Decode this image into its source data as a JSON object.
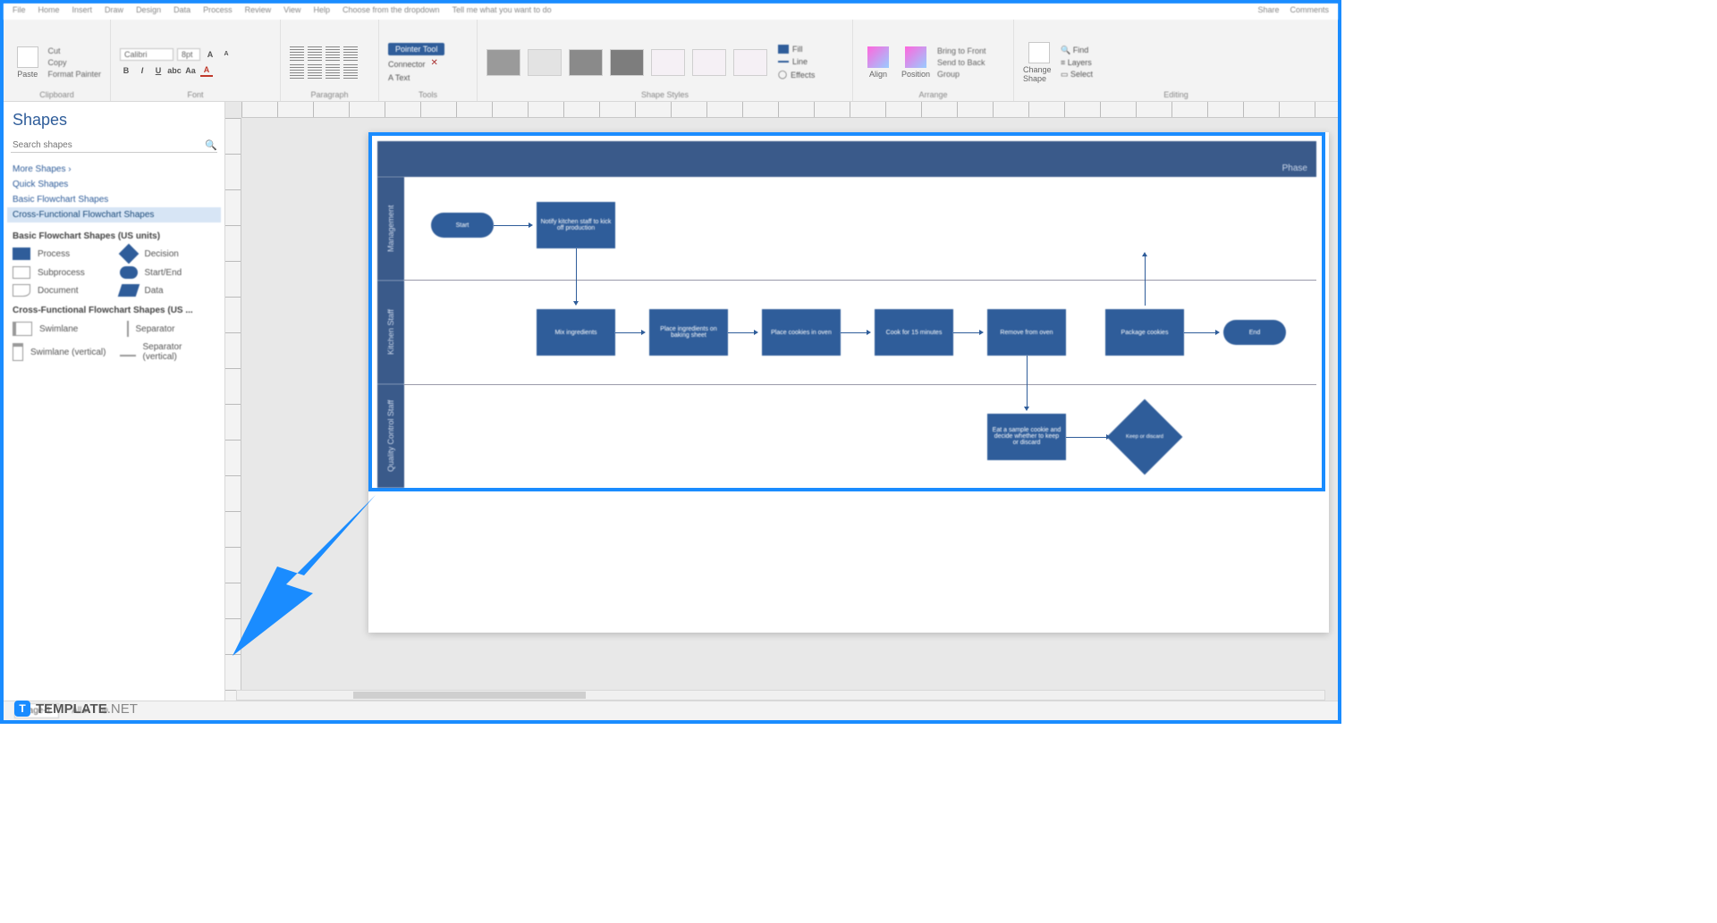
{
  "titlebar": {
    "tabs": [
      "File",
      "Home",
      "Insert",
      "Draw",
      "Design",
      "Data",
      "Process",
      "Review",
      "View",
      "Help"
    ],
    "cmd": "Choose from the dropdown",
    "search": "Tell me what you want to do",
    "share": "Share",
    "comments": "Comments"
  },
  "ribbon": {
    "clipboard": {
      "label": "Clipboard",
      "paste": "Paste",
      "cut": "Cut",
      "copy": "Copy",
      "fmt": "Format Painter"
    },
    "font": {
      "label": "Font",
      "name": "Calibri",
      "size": "8pt"
    },
    "paragraph": {
      "label": "Paragraph"
    },
    "tools": {
      "label": "Tools",
      "pointer": "Pointer Tool",
      "connector": "Connector",
      "text": "A Text"
    },
    "styles": {
      "label": "Shape Styles",
      "fill": "Fill",
      "line": "Line",
      "effects": "Effects"
    },
    "arrange": {
      "label": "Arrange",
      "align": "Align",
      "position": "Position",
      "front": "Bring to Front",
      "back": "Send to Back",
      "group": "Group"
    },
    "editing": {
      "label": "Editing",
      "change": "Change Shape",
      "find": "Find",
      "layers": "Layers",
      "select": "Select"
    }
  },
  "sidebar": {
    "title": "Shapes",
    "searchPlaceholder": "Search shapes",
    "links": [
      "More Shapes  ›",
      "Quick Shapes",
      "Basic Flowchart Shapes",
      "Cross-Functional Flowchart Shapes"
    ],
    "cat1": {
      "title": "Basic Flowchart Shapes (US units)",
      "items": [
        "Process",
        "Decision",
        "Subprocess",
        "Start/End",
        "Document",
        "Data"
      ]
    },
    "cat2": {
      "title": "Cross-Functional Flowchart Shapes (US ...",
      "items": [
        "Swimlane",
        "Separator",
        "Swimlane (vertical)",
        "Separator (vertical)"
      ]
    }
  },
  "canvas": {
    "phaseLabel": "Phase",
    "lanes": [
      "Management",
      "Kitchen Staff",
      "Quality Control Staff"
    ],
    "nodes": {
      "start": "Start",
      "notify": "Notify kitchen staff to kick off production",
      "mix": "Mix ingredients",
      "place": "Place ingredients on baking sheet",
      "oven": "Place cookies in oven",
      "cook": "Cook for 15 minutes",
      "remove": "Remove from oven",
      "pkg": "Package cookies",
      "end": "End",
      "sample": "Eat a sample cookie and decide whether to keep or discard",
      "dec": "Keep or discard"
    }
  },
  "status": {
    "page": "Page-1",
    "all": "All  ▸",
    "add": "⊕"
  },
  "watermark": {
    "brand": "TEMPLATE",
    "suffix": ".NET"
  }
}
